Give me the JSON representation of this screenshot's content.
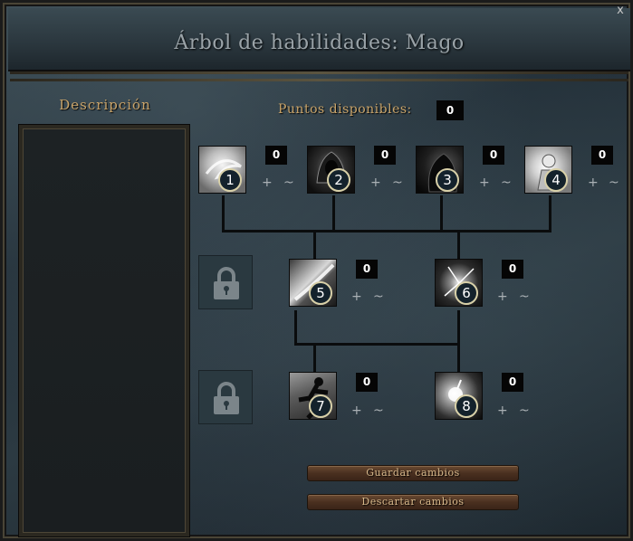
{
  "window": {
    "title": "Árbol de habilidades: Mago",
    "close_label": "x"
  },
  "description": {
    "title": "Descripción"
  },
  "points": {
    "label": "Puntos disponibles:",
    "value": "0"
  },
  "skills": [
    {
      "number": "1",
      "count": "0",
      "plus": "+",
      "minus": "~",
      "icon": "wind-swirl-icon"
    },
    {
      "number": "2",
      "count": "0",
      "plus": "+",
      "minus": "~",
      "icon": "hooded-mage-icon"
    },
    {
      "number": "3",
      "count": "0",
      "plus": "+",
      "minus": "~",
      "icon": "shadow-figure-icon"
    },
    {
      "number": "4",
      "count": "0",
      "plus": "+",
      "minus": "~",
      "icon": "radiant-armor-icon"
    },
    {
      "number": "5",
      "count": "0",
      "plus": "+",
      "minus": "~",
      "icon": "wind-slash-icon"
    },
    {
      "number": "6",
      "count": "0",
      "plus": "+",
      "minus": "~",
      "icon": "lightning-burst-icon"
    },
    {
      "number": "7",
      "count": "0",
      "plus": "+",
      "minus": "~",
      "icon": "leaping-figure-icon"
    },
    {
      "number": "8",
      "count": "0",
      "plus": "+",
      "minus": "~",
      "icon": "energy-orb-icon"
    }
  ],
  "locks": [
    {
      "icon": "padlock-icon"
    },
    {
      "icon": "padlock-icon"
    }
  ],
  "buttons": {
    "save": "Guardar cambios",
    "discard": "Descartar cambios"
  }
}
